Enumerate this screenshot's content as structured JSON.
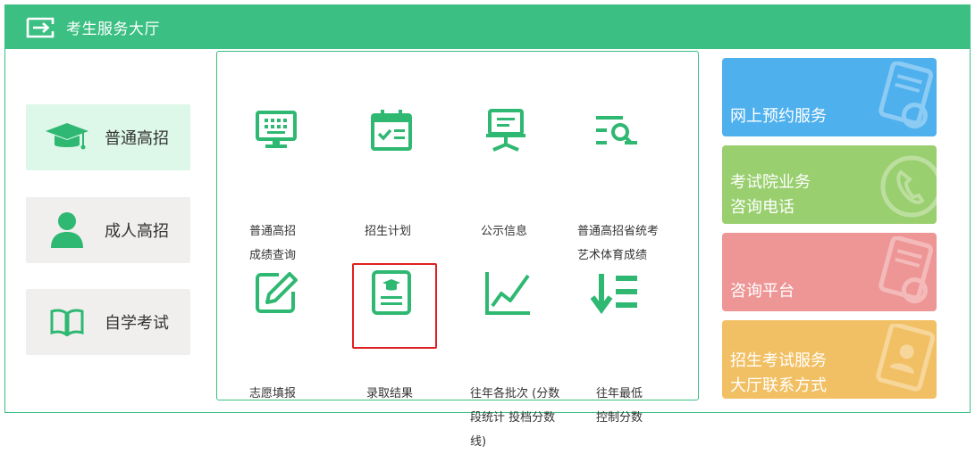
{
  "header": {
    "title": "考生服务大厅",
    "icon": "exit-arrow-icon"
  },
  "left_menu": [
    {
      "label": "普通高招",
      "icon": "graduation-cap-icon",
      "active": true
    },
    {
      "label": "成人高招",
      "icon": "person-icon",
      "active": false
    },
    {
      "label": "自学考试",
      "icon": "open-book-icon",
      "active": false
    }
  ],
  "services": [
    {
      "label": "普通高招成绩查询",
      "line1": "普通高招",
      "line2": "成绩查询",
      "line3": "",
      "icon": "monitor-grid-icon"
    },
    {
      "label": "招生计划",
      "line1": "招生计划",
      "line2": "",
      "line3": "",
      "icon": "calendar-check-icon"
    },
    {
      "label": "公示信息",
      "line1": "公示信息",
      "line2": "",
      "line3": "",
      "icon": "presentation-board-icon"
    },
    {
      "label": "普通高招省统考艺术体育成绩",
      "line1": "普通高招省统考",
      "line2": "艺术体育成绩",
      "line3": "",
      "icon": "list-search-icon"
    },
    {
      "label": "志愿填报",
      "line1": "志愿填报",
      "line2": "",
      "line3": "",
      "icon": "edit-square-icon"
    },
    {
      "label": "录取结果",
      "line1": "录取结果",
      "line2": "",
      "line3": "",
      "icon": "certificate-document-icon"
    },
    {
      "label": "往年各批次（分数段统计 投档分数线）",
      "line1": "往年各批次 (分数",
      "line2": "段统计 投档分数",
      "line3": "线)",
      "icon": "line-chart-icon"
    },
    {
      "label": "往年最低控制分数",
      "line1": "往年最低",
      "line2": "控制分数",
      "line3": "",
      "icon": "sort-descending-icon"
    }
  ],
  "tiles": [
    {
      "label": "网上预约服务",
      "color": "#4fb0ee",
      "icon": "document-search-icon"
    },
    {
      "label": "考试院业务\n咨询电话",
      "color": "#99cf6e",
      "icon": "phone-icon"
    },
    {
      "label": "咨询平台",
      "color": "#ee9595",
      "icon": "document-search-icon"
    },
    {
      "label": "招生考试服务\n大厅联系方式",
      "color": "#f2c064",
      "icon": "contact-card-icon"
    }
  ],
  "colors": {
    "brand_green": "#3bbf82",
    "highlight_red": "#e02020"
  }
}
